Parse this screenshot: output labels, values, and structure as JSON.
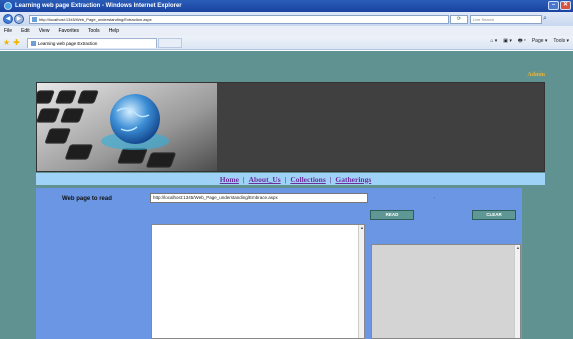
{
  "window": {
    "title": "Learning web page Extraction - Windows Internet Explorer",
    "minimize": "–",
    "close": "✕"
  },
  "address": {
    "url": "http://localhost:1345/Web_Page_understanding/Extraction.aspx",
    "search_placeholder": "Live Search",
    "back": "◀",
    "forward": "▶"
  },
  "menu": {
    "items": [
      "File",
      "Edit",
      "View",
      "Favorites",
      "Tools",
      "Help"
    ]
  },
  "tabs": [
    {
      "label": "Learning web page Extraction"
    }
  ],
  "commandbar": {
    "items": [
      "⌂ ▾",
      "▣ ▾",
      "🖶 ▾",
      "Page ▾",
      "Tools ▾"
    ]
  },
  "page": {
    "admin_link": "Admin",
    "nav": [
      {
        "label": "Home"
      },
      {
        "label": "About_Us"
      },
      {
        "label": "Collections"
      },
      {
        "label": "Gatherings"
      }
    ],
    "nav_separator": "|",
    "form": {
      "label": "Web page to read",
      "url_value": "http://localhost:1345/Web_Page_understanding/Embrace.aspx",
      "read_button": "READ",
      "clear_button": "CLEAR",
      "dot": "."
    }
  },
  "colors": {
    "page_bg": "#5f9290",
    "content_bg": "#6a96e4",
    "nav_strip": "#9fd2f7",
    "nav_link": "#6c2e9c",
    "admin_link": "#e8b33a",
    "banner_bg": "#404040"
  }
}
